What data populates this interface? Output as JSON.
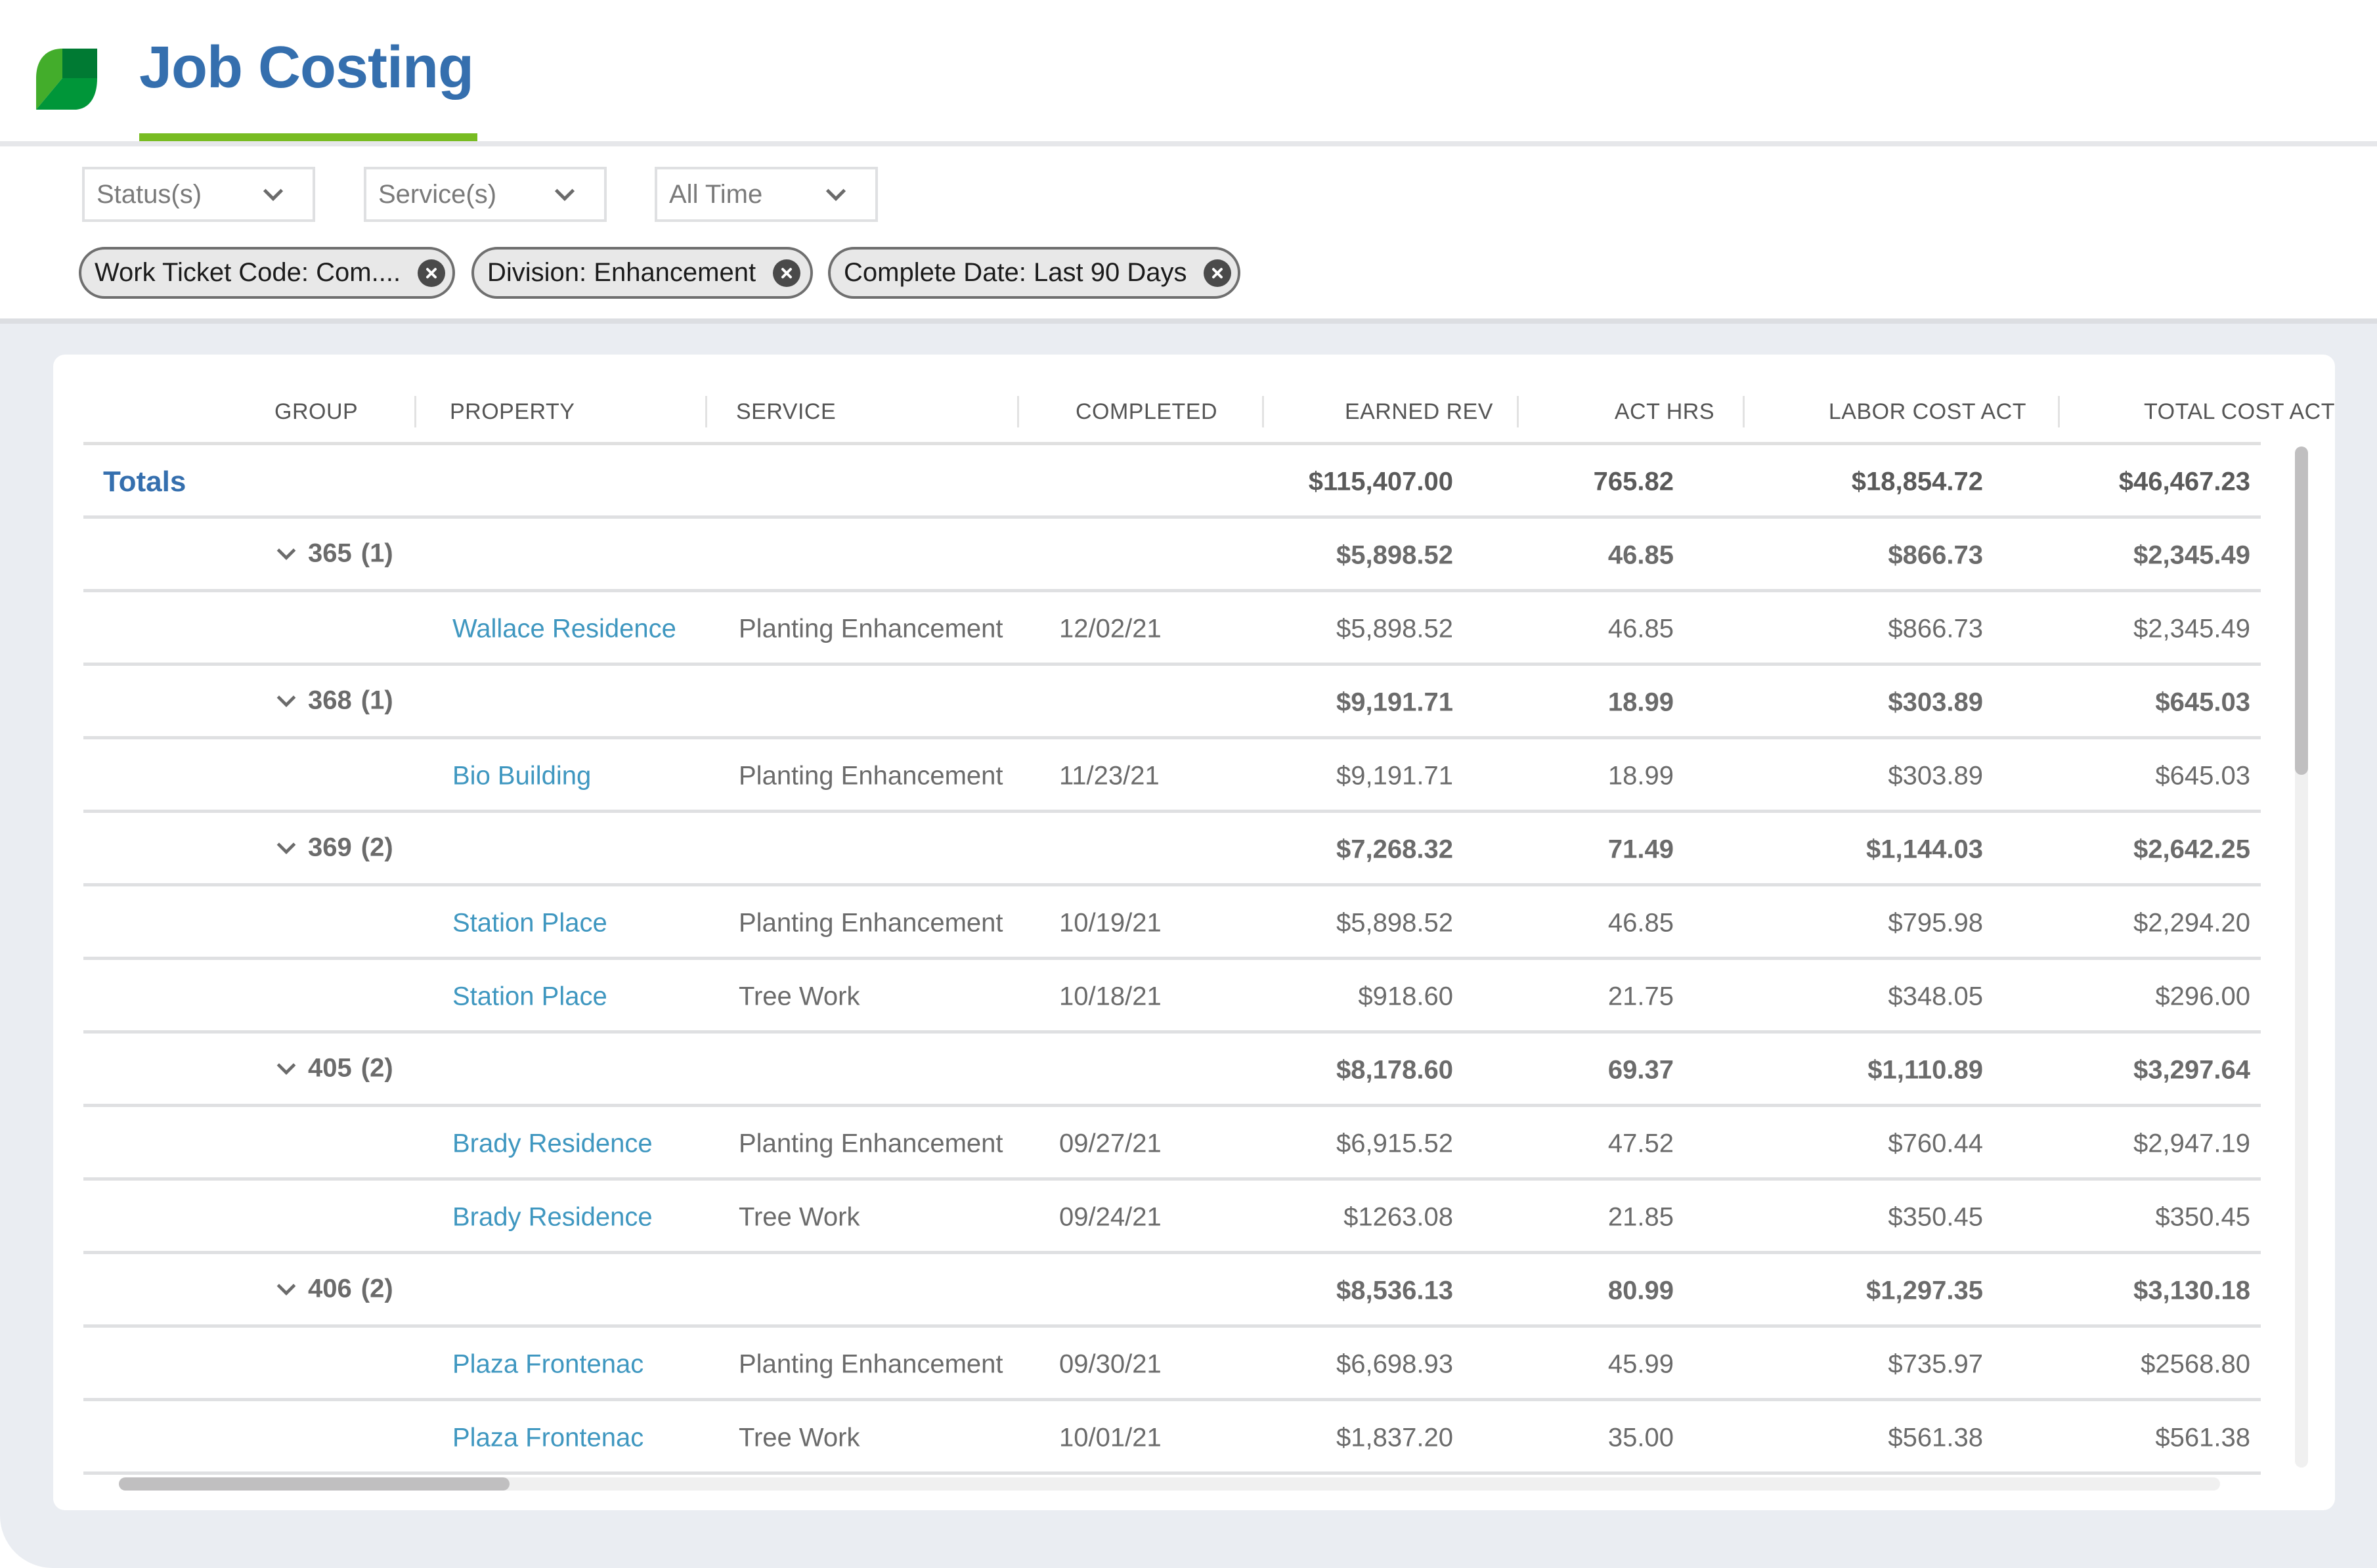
{
  "header": {
    "title": "Job Costing",
    "logo_icon": "leaf-logo-icon",
    "colors": {
      "title": "#356fae",
      "accent_underline": "#78bc22",
      "logo_light": "#43ad2b",
      "logo_mid": "#009639",
      "logo_dark": "#007a33"
    }
  },
  "filters": {
    "dropdowns": [
      {
        "label": "Status(s)",
        "icon": "chevron-down-icon"
      },
      {
        "label": "Service(s)",
        "icon": "chevron-down-icon"
      },
      {
        "label": "All Time",
        "icon": "chevron-down-icon"
      }
    ],
    "chips": [
      {
        "label": "Work Ticket Code: Com....",
        "icon": "remove-circle-icon"
      },
      {
        "label": "Division: Enhancement",
        "icon": "remove-circle-icon"
      },
      {
        "label": "Complete Date: Last 90 Days",
        "icon": "remove-circle-icon"
      }
    ]
  },
  "table": {
    "columns": [
      "GROUP",
      "PROPERTY",
      "SERVICE",
      "COMPLETED",
      "EARNED REV",
      "ACT HRS",
      "LABOR COST ACT",
      "TOTAL COST ACT"
    ],
    "totals": {
      "label": "Totals",
      "earned_rev": "$115,407.00",
      "act_hrs": "765.82",
      "labor_cost_act": "$18,854.72",
      "total_cost_act": "$46,467.23"
    },
    "rows": [
      {
        "type": "group",
        "group": "365",
        "count": "(1)",
        "earned_rev": "$5,898.52",
        "act_hrs": "46.85",
        "labor_cost_act": "$866.73",
        "total_cost_act": "$2,345.49"
      },
      {
        "type": "item",
        "property": "Wallace Residence",
        "service": "Planting Enhancement",
        "completed": "12/02/21",
        "earned_rev": "$5,898.52",
        "act_hrs": "46.85",
        "labor_cost_act": "$866.73",
        "total_cost_act": "$2,345.49"
      },
      {
        "type": "group",
        "group": "368",
        "count": "(1)",
        "earned_rev": "$9,191.71",
        "act_hrs": "18.99",
        "labor_cost_act": "$303.89",
        "total_cost_act": "$645.03"
      },
      {
        "type": "item",
        "property": "Bio Building",
        "service": "Planting Enhancement",
        "completed": "11/23/21",
        "earned_rev": "$9,191.71",
        "act_hrs": "18.99",
        "labor_cost_act": "$303.89",
        "total_cost_act": "$645.03"
      },
      {
        "type": "group",
        "group": "369",
        "count": "(2)",
        "earned_rev": "$7,268.32",
        "act_hrs": "71.49",
        "labor_cost_act": "$1,144.03",
        "total_cost_act": "$2,642.25"
      },
      {
        "type": "item",
        "property": "Station Place",
        "service": "Planting Enhancement",
        "completed": "10/19/21",
        "earned_rev": "$5,898.52",
        "act_hrs": "46.85",
        "labor_cost_act": "$795.98",
        "total_cost_act": "$2,294.20"
      },
      {
        "type": "item",
        "property": "Station Place",
        "service": "Tree Work",
        "completed": "10/18/21",
        "earned_rev": "$918.60",
        "act_hrs": "21.75",
        "labor_cost_act": "$348.05",
        "total_cost_act": "$296.00"
      },
      {
        "type": "group",
        "group": "405",
        "count": "(2)",
        "earned_rev": "$8,178.60",
        "act_hrs": "69.37",
        "labor_cost_act": "$1,110.89",
        "total_cost_act": "$3,297.64"
      },
      {
        "type": "item",
        "property": "Brady Residence",
        "service": "Planting Enhancement",
        "completed": "09/27/21",
        "earned_rev": "$6,915.52",
        "act_hrs": "47.52",
        "labor_cost_act": "$760.44",
        "total_cost_act": "$2,947.19"
      },
      {
        "type": "item",
        "property": "Brady Residence",
        "service": "Tree Work",
        "completed": "09/24/21",
        "earned_rev": "$1263.08",
        "act_hrs": "21.85",
        "labor_cost_act": "$350.45",
        "total_cost_act": "$350.45"
      },
      {
        "type": "group",
        "group": "406",
        "count": "(2)",
        "earned_rev": "$8,536.13",
        "act_hrs": "80.99",
        "labor_cost_act": "$1,297.35",
        "total_cost_act": "$3,130.18"
      },
      {
        "type": "item",
        "property": "Plaza Frontenac",
        "service": "Planting Enhancement",
        "completed": "09/30/21",
        "earned_rev": "$6,698.93",
        "act_hrs": "45.99",
        "labor_cost_act": "$735.97",
        "total_cost_act": "$2568.80"
      },
      {
        "type": "item",
        "property": "Plaza Frontenac",
        "service": "Tree Work",
        "completed": "10/01/21",
        "earned_rev": "$1,837.20",
        "act_hrs": "35.00",
        "labor_cost_act": "$561.38",
        "total_cost_act": "$561.38"
      }
    ],
    "colors": {
      "link": "#3f97c0",
      "totals_label": "#356fae"
    }
  }
}
